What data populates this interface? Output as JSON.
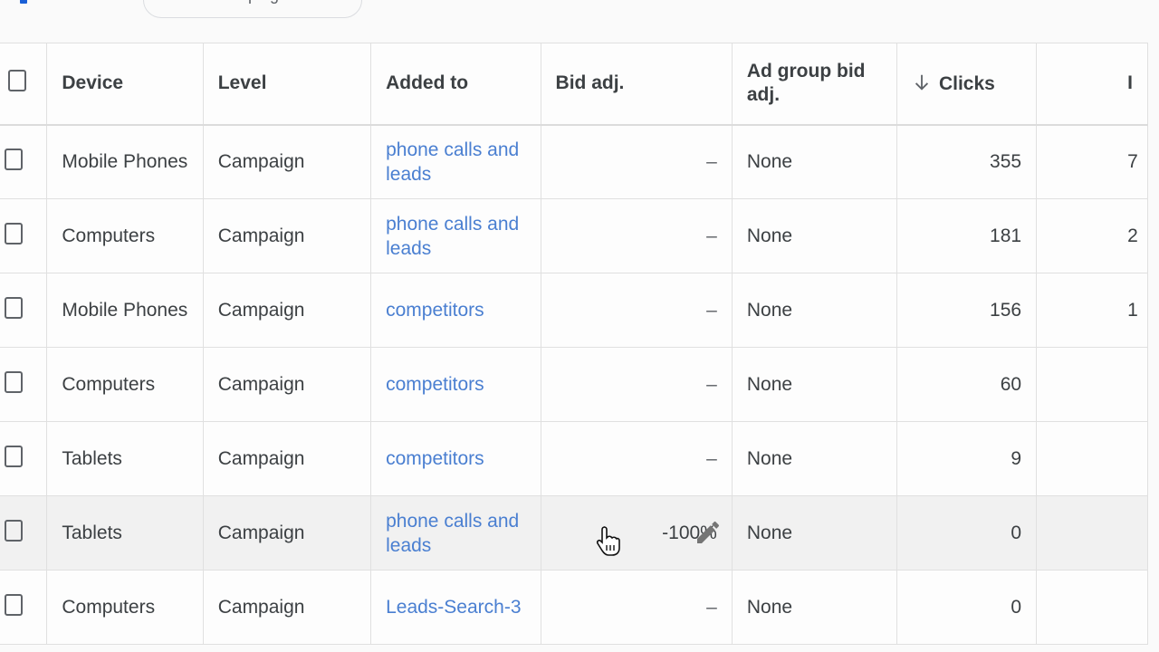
{
  "topbar": {
    "chip_label": "campaign"
  },
  "table": {
    "columns": {
      "device": "Device",
      "level": "Level",
      "added_to": "Added to",
      "bid_adj": "Bid adj.",
      "ad_group_bid_adj": "Ad group bid adj.",
      "clicks": "Clicks",
      "next": "I"
    },
    "sort": {
      "column": "clicks",
      "direction": "descending",
      "icon": "arrow-down-icon"
    },
    "rows": [
      {
        "device": "Mobile Phones",
        "level": "Campaign",
        "added_to": "phone calls and leads",
        "bid_adj": "–",
        "ad_group_bid_adj": "None",
        "clicks": "355",
        "next": "7"
      },
      {
        "device": "Computers",
        "level": "Campaign",
        "added_to": "phone calls and leads",
        "bid_adj": "–",
        "ad_group_bid_adj": "None",
        "clicks": "181",
        "next": "2"
      },
      {
        "device": "Mobile Phones",
        "level": "Campaign",
        "added_to": "competitors",
        "bid_adj": "–",
        "ad_group_bid_adj": "None",
        "clicks": "156",
        "next": "1"
      },
      {
        "device": "Computers",
        "level": "Campaign",
        "added_to": "competitors",
        "bid_adj": "–",
        "ad_group_bid_adj": "None",
        "clicks": "60",
        "next": ""
      },
      {
        "device": "Tablets",
        "level": "Campaign",
        "added_to": "competitors",
        "bid_adj": "–",
        "ad_group_bid_adj": "None",
        "clicks": "9",
        "next": ""
      },
      {
        "device": "Tablets",
        "level": "Campaign",
        "added_to": "phone calls and leads",
        "bid_adj": "-100%",
        "ad_group_bid_adj": "None",
        "clicks": "0",
        "next": "",
        "hovered": true,
        "edit_icon": "pencil-icon"
      },
      {
        "device": "Computers",
        "level": "Campaign",
        "added_to": "Leads-Search-3",
        "bid_adj": "–",
        "ad_group_bid_adj": "None",
        "clicks": "0",
        "next": ""
      }
    ]
  },
  "colors": {
    "link": "#4a7fd1",
    "text": "#3c4043",
    "hover_row": "#f1f1f1",
    "accent": "#1a5fd6"
  }
}
